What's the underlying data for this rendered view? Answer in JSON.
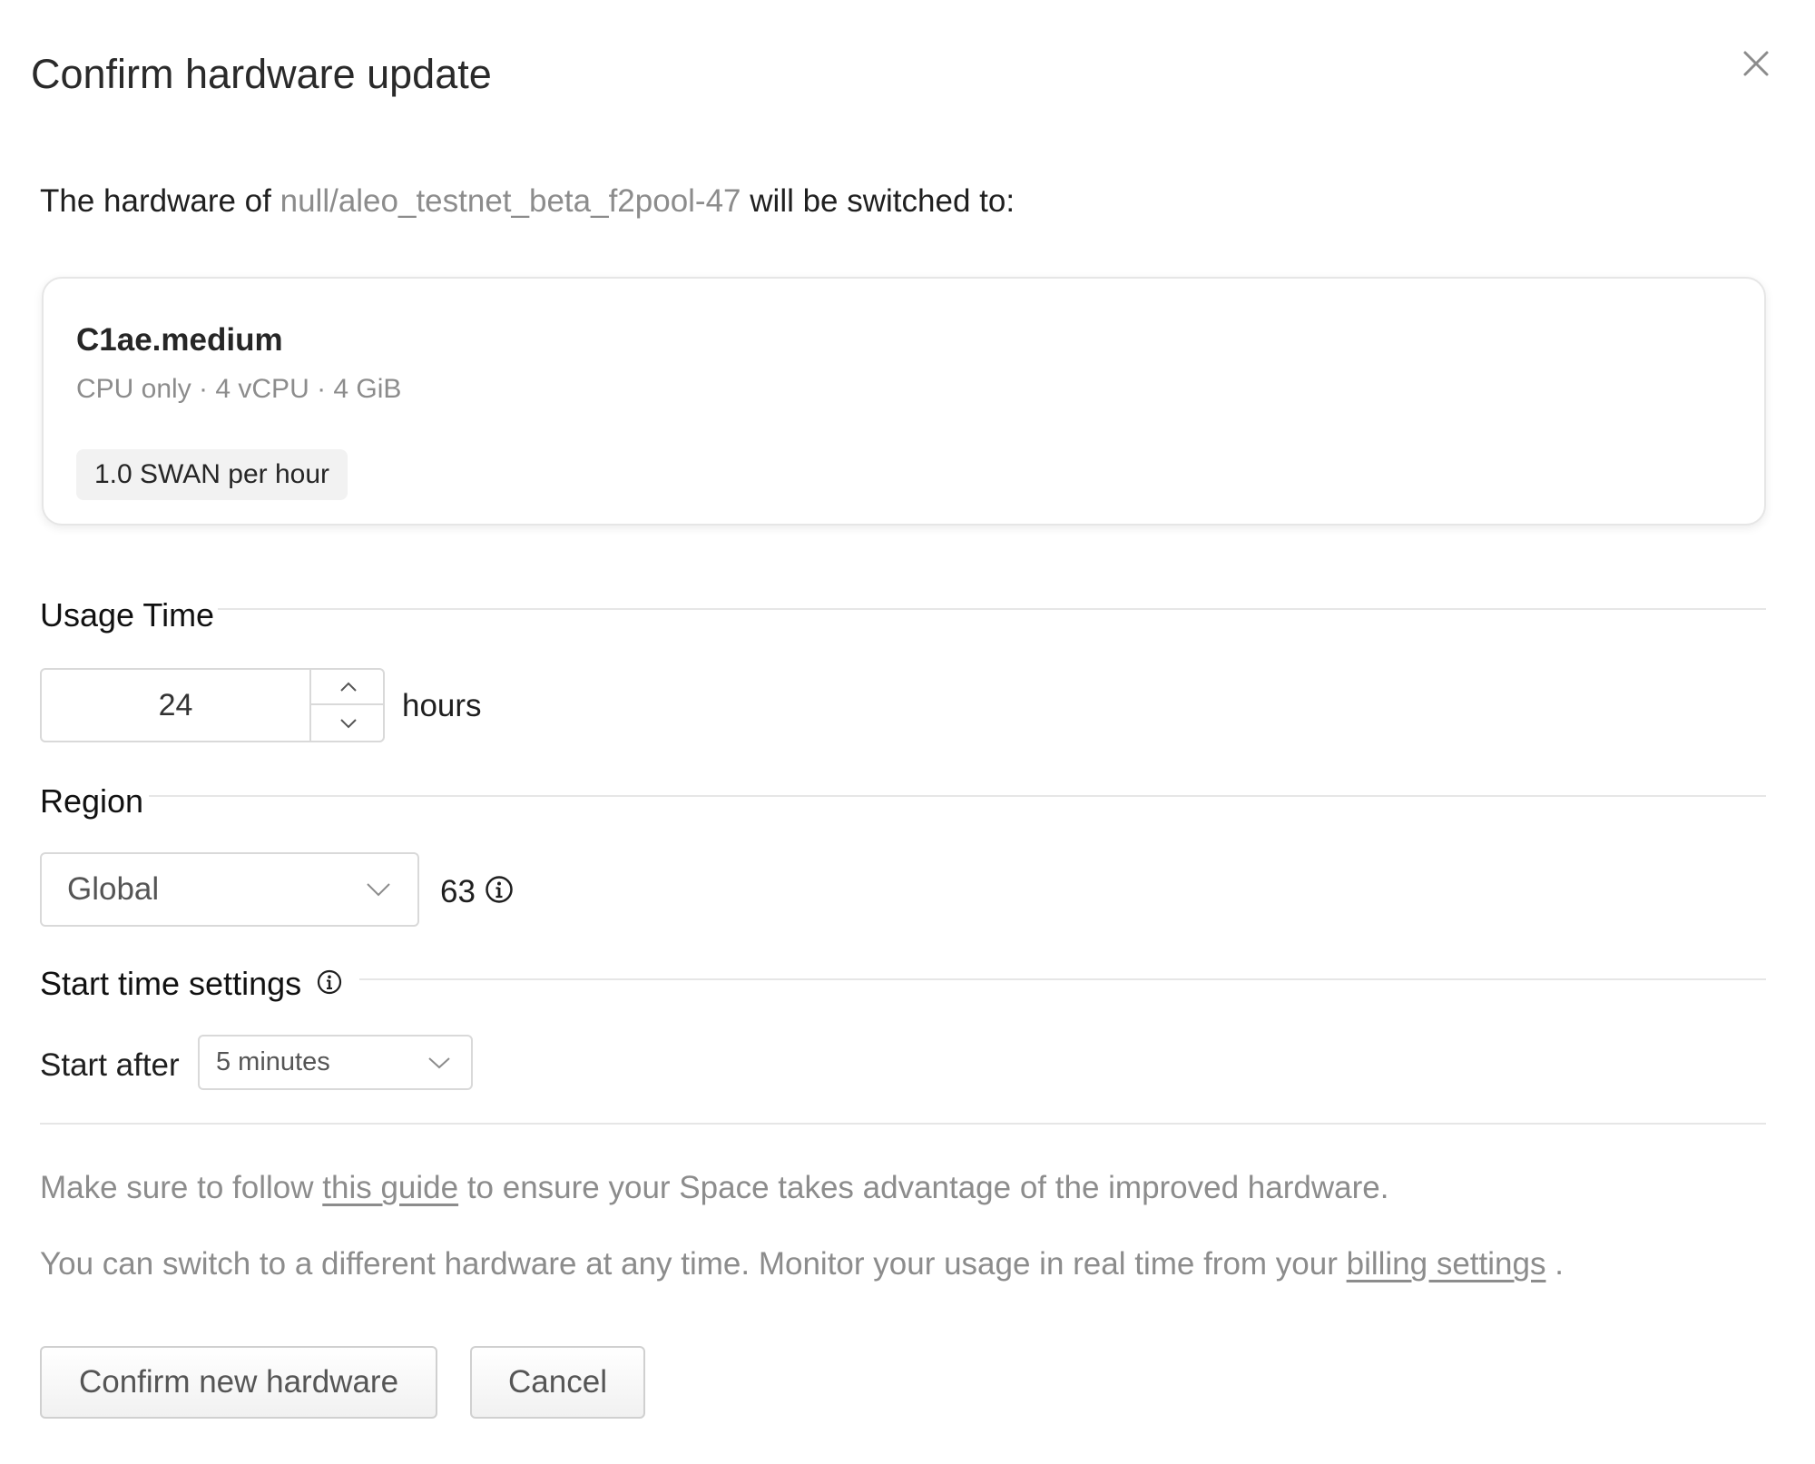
{
  "dialog": {
    "title": "Confirm hardware update",
    "close_icon": "close-icon"
  },
  "intro": {
    "prefix": "The hardware of",
    "space_name": "null/aleo_testnet_beta_f2pool-47",
    "suffix": "will be switched to:"
  },
  "hardware": {
    "name": "C1ae.medium",
    "specs": "CPU only · 4 vCPU · 4 GiB",
    "price": "1.0 SWAN per hour"
  },
  "usage_time": {
    "title": "Usage Time",
    "value": "24",
    "unit": "hours",
    "up_icon": "chevron-up-icon",
    "down_icon": "chevron-down-icon"
  },
  "region": {
    "title": "Region",
    "selected": "Global",
    "count": "63",
    "info_icon": "info-icon"
  },
  "start_time": {
    "title": "Start time settings",
    "info_icon": "info-icon",
    "label": "Start after",
    "selected": "5 minutes"
  },
  "notes": {
    "guide_prefix": "Make sure to follow",
    "guide_link": "this guide",
    "guide_suffix": "to ensure your Space takes advantage of the improved hardware.",
    "billing_prefix": "You can switch to a different hardware at any time. Monitor your usage in real time from your",
    "billing_link": "billing settings",
    "billing_suffix": "."
  },
  "actions": {
    "confirm_label": "Confirm new hardware",
    "cancel_label": "Cancel"
  }
}
